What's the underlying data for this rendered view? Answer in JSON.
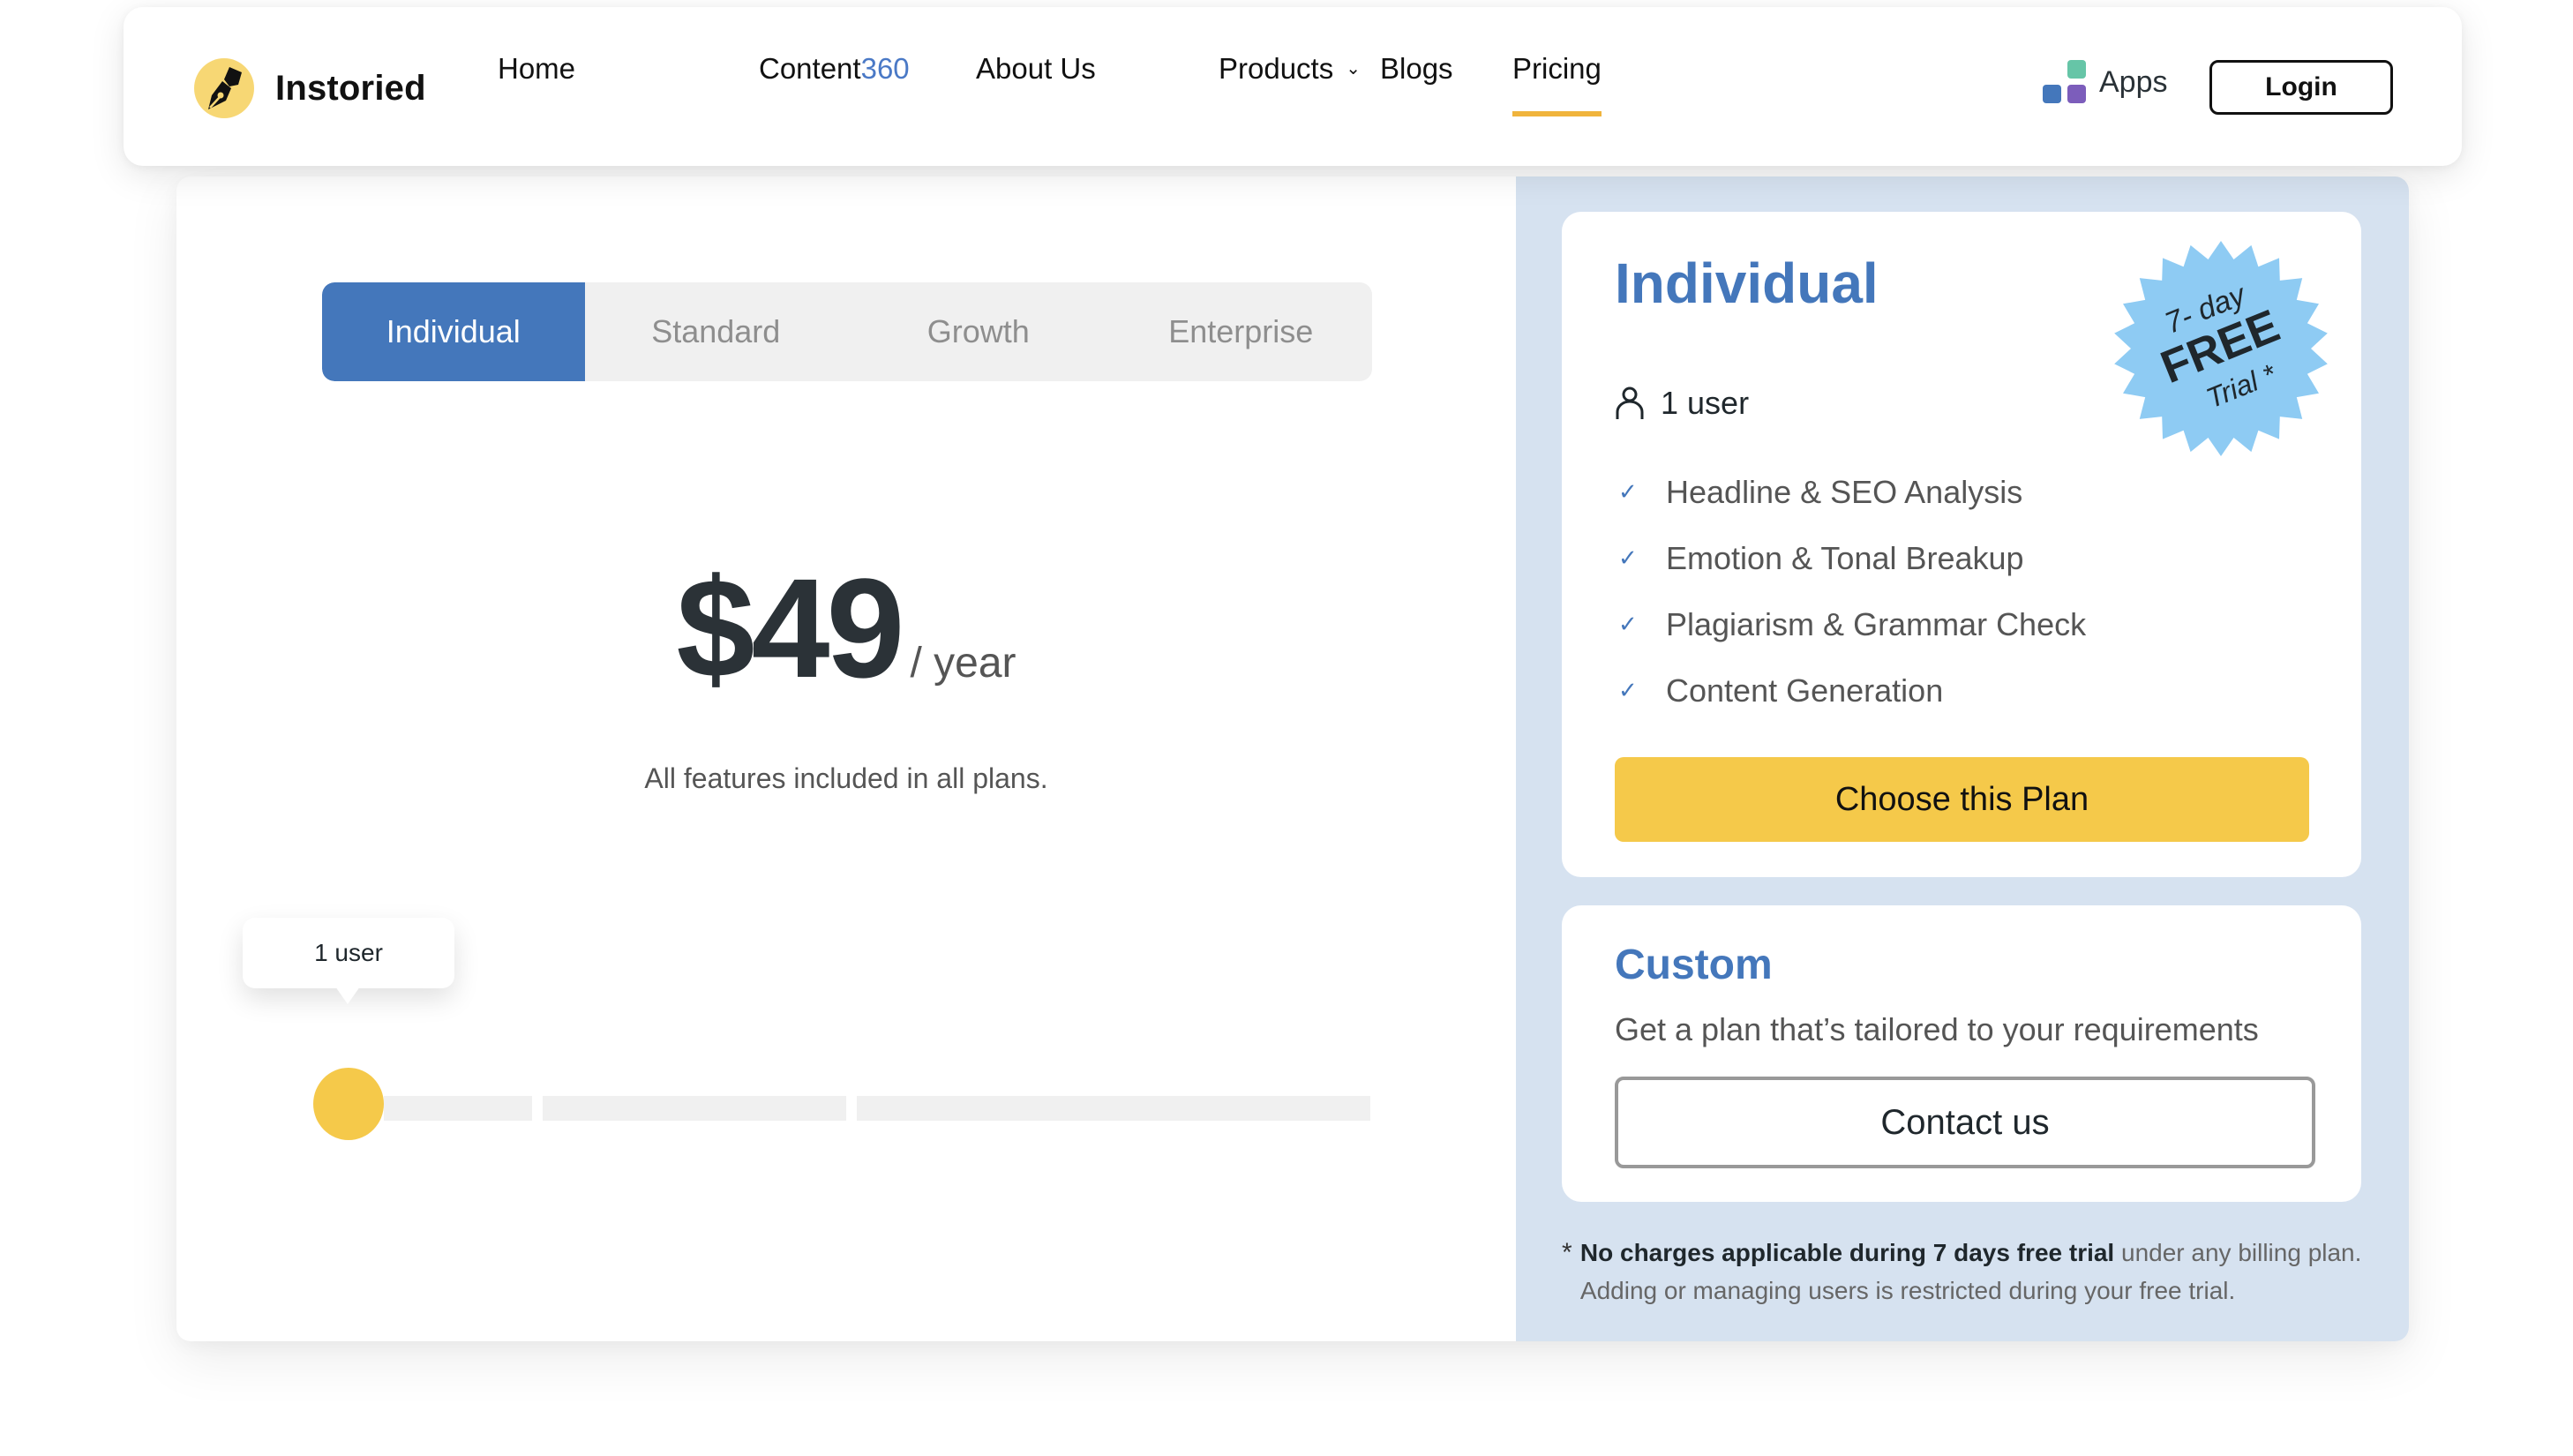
{
  "header": {
    "brand": "Instoried",
    "nav": {
      "home": "Home",
      "content_prefix": "Content",
      "content_accent": "360",
      "about": "About Us",
      "products": "Products",
      "blogs": "Blogs",
      "pricing": "Pricing",
      "active": "Pricing"
    },
    "apps_label": "Apps",
    "login_label": "Login"
  },
  "pricing": {
    "tabs": [
      {
        "label": "Individual",
        "active": true
      },
      {
        "label": "Standard",
        "active": false
      },
      {
        "label": "Growth",
        "active": false
      },
      {
        "label": "Enterprise",
        "active": false
      }
    ],
    "price": "$49",
    "period": "/ year",
    "note": "All features included in all plans.",
    "slider": {
      "tooltip": "1 user",
      "value": 1,
      "position_fraction": 0
    }
  },
  "plan_card": {
    "title": "Individual",
    "users": "1 user",
    "badge": {
      "line1": "7- day",
      "line2": "FREE",
      "line3": "Trial *"
    },
    "features": [
      "Headline & SEO Analysis",
      "Emotion & Tonal Breakup",
      "Plagiarism & Grammar Check",
      "Content Generation"
    ],
    "cta": "Choose this Plan"
  },
  "custom_card": {
    "title": "Custom",
    "subtitle": "Get a plan that’s tailored to your requirements",
    "cta": "Contact us"
  },
  "footnote": {
    "star": "*",
    "bold": "No charges applicable during 7 days free trial",
    "rest": " under any billing plan. Adding or managing users is restricted during your free trial."
  },
  "colors": {
    "brand_blue": "#4477bb",
    "accent_yellow": "#f5c94a",
    "underline_orange": "#f0b43c",
    "panel_bg": "#d6e2f0",
    "badge_blue": "#8ecbf3"
  }
}
